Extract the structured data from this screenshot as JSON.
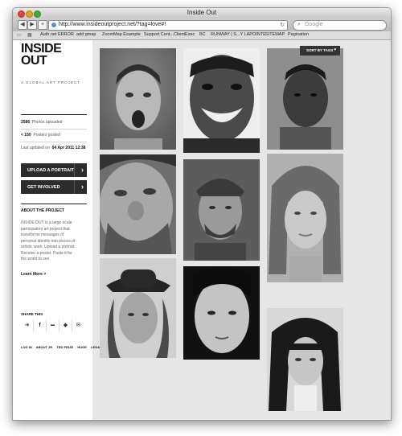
{
  "window": {
    "title": "Inside Out",
    "url": "http://www.insideoutproject.net/?tag=love#!",
    "search_placeholder": "Google",
    "bookmarks": [
      "Auth.net ERROR",
      "add gmap",
      "ZoomMap Example",
      "Support Cent...ClientExec",
      "BC",
      "RUNWAY | S...Y LAPOINTE",
      "SITEMAP",
      "Pagination"
    ]
  },
  "sidebar": {
    "logo_line1": "INSIDE",
    "logo_line2": "OUT",
    "tagline": "A GLOBAL ART PROJECT",
    "photos_count": "2586",
    "photos_label": "Photos uploaded",
    "posters_count": "< 150",
    "posters_label": "Posters posted",
    "updated_label": "Last updated on",
    "updated_date": "04 Apr 2011 12:38",
    "upload_label": "UPLOAD A PORTRAIT",
    "involved_label": "GET INVOLVED",
    "about_heading": "ABOUT THE PROJECT",
    "about_text": "INSIDE OUT is a large-scale participatory art project that transforms messages of personal identity into pieces of artistic work. Upload a portrait. Receive a poster. Paste it for the world to see.",
    "learn_more": "Learn More >",
    "share_heading": "SHARE THIS",
    "footer": [
      "LOG IN",
      "ABOUT JR",
      "TED PRIZE",
      "HUGE",
      "LEGAL"
    ]
  },
  "gallery": {
    "sort_label": "SORT BY TAGS"
  },
  "icons": {
    "back": "back-arrow-icon",
    "forward": "forward-arrow-icon",
    "add": "plus-icon",
    "reload": "reload-icon",
    "search": "search-icon",
    "share": [
      "share-icon",
      "facebook-icon",
      "digg-icon",
      "delicious-icon",
      "mail-icon"
    ]
  },
  "colors": {
    "sidebar_bg": "#ffffff",
    "content_bg": "#e6e6e6",
    "cta_bg": "#2c2c2c"
  }
}
